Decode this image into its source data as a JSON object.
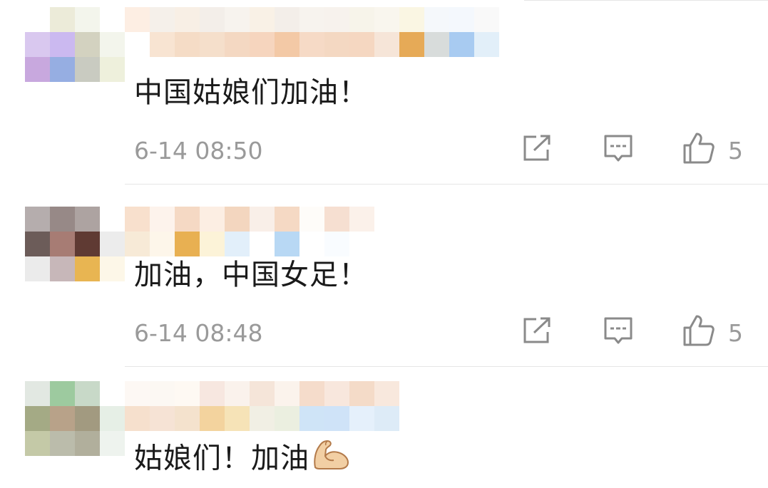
{
  "comments": [
    {
      "avatar_colors": [
        "#ffffff",
        "#ecebd9",
        "#f3f5ec",
        "#ffffff",
        "#d9c8ef",
        "#cbb9f0",
        "#d3d2c0",
        "#f3f5ec",
        "#c8a8de",
        "#96aee2",
        "#c9cbc1",
        "#eef0dc",
        "#e1e1e9",
        "#c2c9b4",
        "#f2d277",
        "#fdf8e4"
      ],
      "name_colors": [
        "#fdeee3",
        "#f5f0ea",
        "#f8efe5",
        "#f3eee9",
        "#f7f3ee",
        "#f9f1e6",
        "#f3eee9",
        "#f7f3ee",
        "#f7f2ed",
        "#f7f4ea",
        "#f9f6ee",
        "#faf6e3",
        "#f5f8fb",
        "#f4f8fd",
        "#f9f9f9",
        "#ffffff",
        "#f8e4d2",
        "#f5dcc6",
        "#f5dfcb",
        "#f4d8c2",
        "#f6d5be",
        "#f3c9a6",
        "#f6dac6",
        "#f4d8c2",
        "#f5d7c1",
        "#f6e5d8",
        "#e6aa57",
        "#d8dcdb",
        "#a8cbf1",
        "#e2eff9"
      ],
      "text": "中国姑娘们加油！",
      "timestamp": "6-14 08:50",
      "likes": "5"
    },
    {
      "avatar_colors": [
        "#b5adad",
        "#978987",
        "#ada3a1",
        "#ffffff",
        "#6c5c59",
        "#a77c74",
        "#5f3a33",
        "#ececec",
        "#ebebeb",
        "#c7b7b9",
        "#e8b552",
        "#fdf7e8",
        "#ffffff",
        "#f6f5f6",
        "#fdf7e8",
        "#ffffff"
      ],
      "name_colors": [
        "#f8e0cd",
        "#fdf3ec",
        "#f5d9c4",
        "#fceee3",
        "#f3d6bf",
        "#f9efe8",
        "#f5d9c4",
        "#fefcf9",
        "#f6dfd1",
        "#fbf1ea",
        "#f7ead7",
        "#fdf6ea",
        "#e8b052",
        "#fcf3d8",
        "#e2effa",
        "#ffffff",
        "#b8d8f4",
        "#ffffff",
        "#f9fcff",
        "#ffffff"
      ],
      "text": "加油，中国女足！",
      "timestamp": "6-14 08:48",
      "likes": "5"
    },
    {
      "avatar_colors": [
        "#e2e8e2",
        "#9dca9f",
        "#c8d9c8",
        "#ffffff",
        "#a4aa85",
        "#b8a289",
        "#a29a80",
        "#e6efe6",
        "#c4c9a7",
        "#bbbcab",
        "#b1af9c",
        "#eef3ee",
        "#e4eae4",
        "#9da29d",
        "#c9d1c9",
        "#ffffff"
      ],
      "name_colors": [
        "#fdf8f4",
        "#fcf8f3",
        "#fef9f3",
        "#f7e7e0",
        "#faf2ec",
        "#f5e5d9",
        "#fbf3ec",
        "#f5dccb",
        "#f8e7dd",
        "#f4dbc8",
        "#f8e8dd",
        "#f6e0cd",
        "#f6e3d5",
        "#f4e2cd",
        "#f3d39e",
        "#f6e3b7",
        "#f1efe4",
        "#ebefe0",
        "#cfe4f7",
        "#cfe3f8",
        "#e5f0fb",
        "#ddebf7"
      ],
      "text": "姑娘们！加油",
      "emoji": "flexed-biceps-icon"
    }
  ],
  "actions": {
    "share_icon": "share-icon",
    "comment_icon": "comment-icon",
    "like_icon": "thumbs-up-icon"
  },
  "colors": {
    "text": "#1a1a1a",
    "meta": "#9a9a9a",
    "divider": "#e6e6e6"
  }
}
